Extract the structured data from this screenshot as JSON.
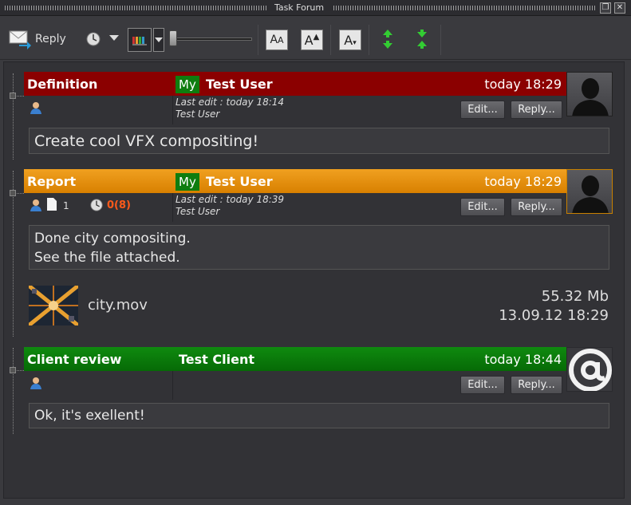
{
  "window": {
    "title": "Task Forum"
  },
  "toolbar": {
    "reply_label": "Reply"
  },
  "posts": [
    {
      "type": "Definition",
      "my": "My",
      "user": "Test User",
      "time": "today 18:29",
      "last_edit": "Last edit : today 18:14",
      "editor": "Test User",
      "edit_label": "Edit...",
      "reply_label": "Reply...",
      "message_lines": [
        "Create cool VFX compositing!"
      ],
      "color": "#8b0000"
    },
    {
      "type": "Report",
      "my": "My",
      "user": "Test User",
      "time": "today 18:29",
      "last_edit": "Last edit : today 18:39",
      "editor": "Test User",
      "edit_label": "Edit...",
      "reply_label": "Reply...",
      "files_count": "1",
      "timer": "0(8)",
      "message_lines": [
        "Done city compositing.",
        "See the file attached."
      ],
      "attachment": {
        "name": "city.mov",
        "size": "55.32 Mb",
        "date": "13.09.12 18:29"
      },
      "color": "#e8900a"
    },
    {
      "type": "Client review",
      "user": "Test Client",
      "time": "today 18:44",
      "edit_label": "Edit...",
      "reply_label": "Reply...",
      "message_lines": [
        "Ok, it's exellent!"
      ],
      "color": "#0a7d0a"
    }
  ]
}
